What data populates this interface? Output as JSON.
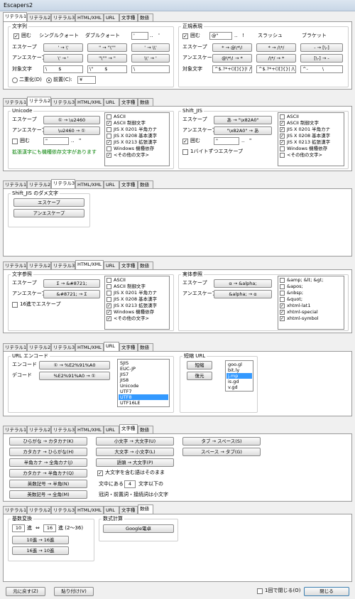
{
  "window": {
    "title": "Escapers2"
  },
  "tabs": [
    "リテラル1",
    "リテラル2",
    "リテラル3",
    "HTML/XML",
    "URL",
    "文字種",
    "数値"
  ],
  "p1": {
    "str_group": "文字列",
    "bracket_cb": "囲む",
    "sq_label": "シングルクォート",
    "dq_label": "ダブルクォート",
    "bracket_open": "'",
    "bracket_close": "'",
    "bracket_dots": "..",
    "escape_label": "エスケープ",
    "unescape_label": "アンエスケープ",
    "esc_btns": [
      "' → \\'",
      "\" → \"\\\"\"",
      "' → \\\\'"
    ],
    "unesc_btns": [
      "\\' → '",
      "\"\\\"\" → \"",
      "\\\\' → '"
    ],
    "target_label": "対象文字",
    "targets": [
      "\\",
      "$",
      "\\\"",
      "$",
      "\\"
    ],
    "double_radio": "二重化(D)",
    "prefix_radio": "前置(C):",
    "prefix_value": "¥",
    "regex_group": "正規表現",
    "regex_bracket_cb": "囲む",
    "regex_open": "@\"",
    "regex_dots": "..",
    "regex_close": "!",
    "slash_label": "スラッシュ",
    "bracket_label": "ブラケット",
    "regex_esc_btns": [
      "* → @\\*\\!",
      "* → /\\*/",
      "- → [\\-]"
    ],
    "regex_unesc_btns": [
      "@\\*\\! → *",
      "/\\*/ → *",
      "[\\-] → -"
    ],
    "regex_targets": [
      "^$.?*+()[]{}|!",
      "/\\",
      "^$.?*+()[]{}|",
      "/\\",
      "^-",
      "\\"
    ]
  },
  "p2": {
    "unicode_group": "Unicode",
    "escape_label": "エスケープ",
    "unescape_label": "アンエスケープ",
    "esc_btn": "① → \\u2460",
    "unesc_btn": "\\u2460 → ①",
    "bracket_cb": "囲む",
    "br_open": "\"",
    "br_dots": "..",
    "br_close": "\"",
    "note": "拡張漢字にも機種依存文字があります",
    "charsets": [
      {
        "label": "ASCII",
        "checked": false
      },
      {
        "label": "ASCII 制御文字",
        "checked": true
      },
      {
        "label": "JIS X 0201 半角カナ",
        "checked": false
      },
      {
        "label": "JIS X 0208 基本漢字",
        "checked": false
      },
      {
        "label": "JIS X 0213 拡張漢字",
        "checked": true
      },
      {
        "label": "Windows 機種依存",
        "checked": false
      },
      {
        "label": "<その他の文字>",
        "checked": true
      }
    ],
    "sjis_group": "Shift_JIS",
    "sjis_esc_btn": "あ → \"\\x82A0\"",
    "sjis_unesc_btn": "\"\\x82A0\" → あ",
    "sjis_bracket_cb": "囲む",
    "sjis_open": "\"",
    "sjis_dots": "..",
    "sjis_close": "\"",
    "byte_cb": "1バイトずつエスケープ",
    "sjis_charsets": [
      {
        "label": "ASCII",
        "checked": false
      },
      {
        "label": "ASCII 制御文字",
        "checked": true
      },
      {
        "label": "JIS X 0201 半角カナ",
        "checked": true
      },
      {
        "label": "JIS X 0208 基本漢字",
        "checked": true
      },
      {
        "label": "JIS X 0213 拡張漢字",
        "checked": true
      },
      {
        "label": "Windows 機種依存",
        "checked": false
      },
      {
        "label": "<その他の文字>",
        "checked": false
      }
    ]
  },
  "p3": {
    "group": "Shift_JIS のダメ文字",
    "esc_btn": "エスケープ",
    "unesc_btn": "アンエスケープ"
  },
  "p4": {
    "ref_group": "文字参照",
    "escape_label": "エスケープ",
    "unescape_label": "アンエスケープ",
    "esc_btn": "Σ → &#8721;",
    "unesc_btn": "&#8721; → Σ",
    "hex_cb": "16進でエスケープ",
    "charsets": [
      {
        "label": "ASCII",
        "checked": false
      },
      {
        "label": "ASCII 制御文字",
        "checked": false
      },
      {
        "label": "JIS X 0201 半角カナ",
        "checked": false
      },
      {
        "label": "JIS X 0208 基本漢字",
        "checked": false
      },
      {
        "label": "JIS X 0213 拡張漢字",
        "checked": true
      },
      {
        "label": "Windows 機種依存",
        "checked": true
      },
      {
        "label": "<その他の文字>",
        "checked": true
      }
    ],
    "entity_group": "実体参照",
    "ent_esc_btn": "α → &alpha;",
    "ent_unesc_btn": "&alpha; → α",
    "entities": [
      {
        "label": "&amp; &lt; &gt;",
        "checked": false
      },
      {
        "label": "&apos;",
        "checked": false
      },
      {
        "label": "&nbsp;",
        "checked": false
      },
      {
        "label": "&quot;",
        "checked": false
      },
      {
        "label": "xhtml-lat1",
        "checked": true
      },
      {
        "label": "xhtml-special",
        "checked": true
      },
      {
        "label": "xhtml-symbol",
        "checked": true
      }
    ]
  },
  "p5": {
    "url_group": "URL エンコード",
    "encode_label": "エンコード",
    "decode_label": "デコード",
    "enc_btn": "① → %E2%91%A0",
    "dec_btn": "%E2%91%A0 → ①",
    "encodings": [
      "SJIS",
      "EUC-JP",
      "JIS7",
      "JIS8",
      "Unicode",
      "UTF7",
      "UTF8",
      "UTF16LE"
    ],
    "enc_selected": "UTF8",
    "short_group": "短縮 URL",
    "shorten_btn": "短縮",
    "restore_btn": "復元",
    "services": [
      "goo.gl",
      "bit.ly",
      "j.mp",
      "is.gd",
      "v.gd"
    ],
    "svc_selected": "j.mp"
  },
  "p6": {
    "buttons_col1": [
      "ひらがな → カタカナ(K)",
      "カタカナ → ひらがな(H)",
      "半角カナ → 全角カナ(J)",
      "カタカナ → 半角カナ(Q)",
      "英数記号 → 半角(N)",
      "英数記号 → 全角(M)"
    ],
    "buttons_col2": [
      "小文字 → 大文字(U)",
      "大文字 → 小文字(L)",
      "語頭 → 大文字(P)"
    ],
    "buttons_col3": [
      "タブ → スペース(S)",
      "スペース → タブ(G)"
    ],
    "keep_cb": "大文字を含む語はそのまま",
    "within_prefix": "文中にある",
    "within_value": "4",
    "within_suffix": "文字以下の",
    "article_text": "冠詞・前置詞・接続詞は小文字"
  },
  "p7": {
    "radix_group": "基数変換",
    "from_value": "10",
    "radix_label": "進",
    "arrow": "⇔",
    "to_value": "16",
    "radix_range": "進 (2～36)",
    "btn_10to16": "10進 → 16進",
    "btn_16to10": "16進 → 10進",
    "formula_group": "数式計算",
    "google_btn": "Google電卓"
  },
  "bottom": {
    "undo_btn": "元に戻す(Z)",
    "paste_btn": "貼り付け(V)",
    "once_cb": "1回で閉じる(O)",
    "close_btn": "閉じる"
  }
}
